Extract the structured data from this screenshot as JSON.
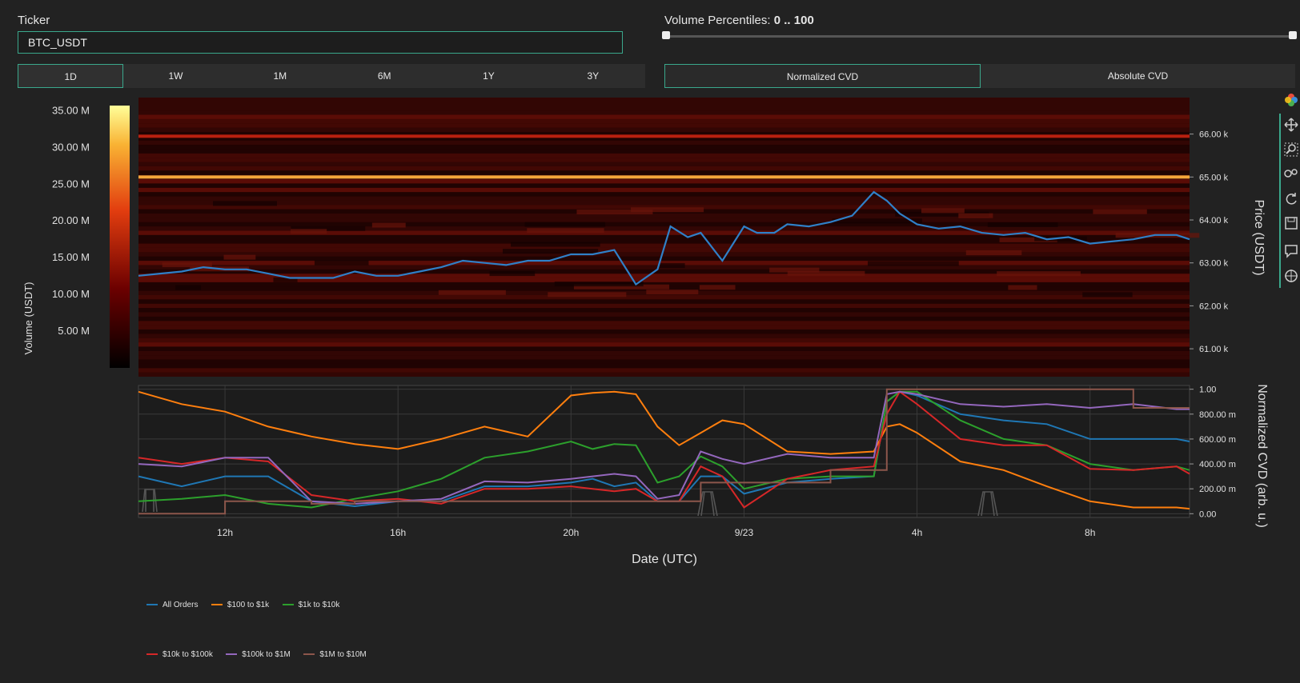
{
  "ticker": {
    "label": "Ticker",
    "value": "BTC_USDT"
  },
  "volume_percentiles": {
    "label": "Volume Percentiles:",
    "value": "0 .. 100"
  },
  "ranges": [
    {
      "label": "1D",
      "active": true
    },
    {
      "label": "1W",
      "active": false
    },
    {
      "label": "1M",
      "active": false
    },
    {
      "label": "6M",
      "active": false
    },
    {
      "label": "1Y",
      "active": false
    },
    {
      "label": "3Y",
      "active": false
    }
  ],
  "cvd_modes": [
    {
      "label": "Normalized CVD",
      "active": true
    },
    {
      "label": "Absolute CVD",
      "active": false
    }
  ],
  "toolbar_icons": [
    "color-wheel-icon",
    "pan-icon",
    "zoom-icon",
    "compare-icon",
    "reset-icon",
    "save-icon",
    "comment-icon",
    "crosshair-icon"
  ],
  "chart_data": [
    {
      "type": "heatmap",
      "colorbar_title": "Volume (USDT)",
      "colorbar_ticks": [
        "35.00 M",
        "30.00 M",
        "25.00 M",
        "20.00 M",
        "15.00 M",
        "10.00 M",
        "5.00 M"
      ],
      "colorbar_values": [
        35,
        30,
        25,
        20,
        15,
        10,
        5
      ],
      "colorbar_range": [
        0,
        35.7
      ],
      "ylabel": "Price (USDT)",
      "y_ticks": [
        "66.00 k",
        "65.00 k",
        "64.00 k",
        "63.00 k",
        "62.00 k",
        "61.00 k"
      ],
      "y_tick_values": [
        66000,
        65000,
        64000,
        63000,
        62000,
        61000
      ],
      "ylim": [
        60350,
        66850
      ],
      "highlight_levels": [
        {
          "price": 65000,
          "volume_m": 28
        },
        {
          "price": 65950,
          "volume_m": 11
        }
      ],
      "price_series": {
        "x": [
          10.0,
          10.5,
          11.0,
          11.5,
          12.0,
          12.5,
          13.0,
          13.5,
          14.0,
          14.5,
          15.0,
          15.5,
          16.0,
          16.5,
          17.0,
          17.5,
          18.0,
          18.5,
          19.0,
          19.5,
          20.0,
          20.5,
          21.0,
          21.5,
          22.0,
          22.3,
          22.7,
          23.0,
          23.5,
          24.0,
          24.3,
          24.7,
          25.0,
          25.5,
          26.0,
          26.5,
          27.0,
          27.3,
          27.6,
          28.0,
          28.5,
          29.0,
          29.5,
          30.0,
          30.5,
          31.0,
          31.5,
          32.0,
          32.5,
          33.0,
          33.5,
          34.0,
          34.3
        ],
        "y": [
          62700,
          62750,
          62800,
          62900,
          62850,
          62850,
          62750,
          62650,
          62650,
          62650,
          62800,
          62700,
          62700,
          62800,
          62900,
          63050,
          63000,
          62950,
          63050,
          63050,
          63200,
          63200,
          63300,
          62500,
          62850,
          63850,
          63600,
          63700,
          63050,
          63850,
          63700,
          63700,
          63900,
          63850,
          63950,
          64100,
          64650,
          64450,
          64150,
          63900,
          63800,
          63850,
          63700,
          63650,
          63700,
          63550,
          63600,
          63450,
          63500,
          63550,
          63650,
          63650,
          63550
        ]
      },
      "xlabel": "Date (UTC)",
      "x_ticks": [
        "12h",
        "16h",
        "20h",
        "9/23",
        "4h",
        "8h"
      ],
      "x_tick_values": [
        12,
        16,
        20,
        24,
        28,
        32
      ],
      "xlim": [
        10,
        34.3
      ]
    },
    {
      "type": "line",
      "ylabel": "Normalized CVD (arb. u.)",
      "y_ticks": [
        "1.00",
        "800.00 m",
        "600.00 m",
        "400.00 m",
        "200.00 m",
        "0.00"
      ],
      "y_tick_values": [
        1.0,
        0.8,
        0.6,
        0.4,
        0.2,
        0.0
      ],
      "ylim": [
        -0.03,
        1.03
      ],
      "xlabel": "Date (UTC)",
      "x_ticks": [
        "12h",
        "16h",
        "20h",
        "9/23",
        "4h",
        "8h"
      ],
      "x_tick_values": [
        12,
        16,
        20,
        24,
        28,
        32
      ],
      "xlim": [
        10,
        34.3
      ],
      "x": [
        10,
        11,
        12,
        13,
        14,
        15,
        16,
        17,
        18,
        19,
        20,
        20.5,
        21,
        21.5,
        22,
        22.5,
        23,
        23.5,
        24,
        25,
        26,
        27,
        27.3,
        27.6,
        28,
        29,
        30,
        31,
        32,
        33,
        34,
        34.3
      ],
      "series": [
        {
          "name": "All Orders",
          "color": "#1f77b4",
          "values": [
            0.3,
            0.22,
            0.3,
            0.3,
            0.1,
            0.06,
            0.1,
            0.1,
            0.22,
            0.22,
            0.25,
            0.28,
            0.22,
            0.25,
            0.1,
            0.1,
            0.3,
            0.3,
            0.16,
            0.25,
            0.28,
            0.3,
            0.9,
            0.98,
            0.95,
            0.8,
            0.75,
            0.72,
            0.6,
            0.6,
            0.6,
            0.58
          ]
        },
        {
          "name": "$100 to $1k",
          "color": "#ff7f0e",
          "values": [
            0.98,
            0.88,
            0.82,
            0.7,
            0.62,
            0.56,
            0.52,
            0.6,
            0.7,
            0.62,
            0.95,
            0.97,
            0.98,
            0.96,
            0.7,
            0.55,
            0.65,
            0.75,
            0.72,
            0.5,
            0.48,
            0.5,
            0.7,
            0.72,
            0.65,
            0.42,
            0.35,
            0.22,
            0.1,
            0.05,
            0.05,
            0.04
          ]
        },
        {
          "name": "$1k to $10k",
          "color": "#2ca02c",
          "values": [
            0.1,
            0.12,
            0.15,
            0.08,
            0.05,
            0.12,
            0.18,
            0.28,
            0.45,
            0.5,
            0.58,
            0.52,
            0.56,
            0.55,
            0.25,
            0.3,
            0.46,
            0.38,
            0.2,
            0.28,
            0.3,
            0.3,
            0.9,
            0.98,
            0.98,
            0.75,
            0.6,
            0.55,
            0.4,
            0.35,
            0.38,
            0.35
          ]
        },
        {
          "name": "$10k to $100k",
          "color": "#d62728",
          "values": [
            0.45,
            0.4,
            0.45,
            0.42,
            0.15,
            0.1,
            0.12,
            0.08,
            0.2,
            0.2,
            0.22,
            0.2,
            0.18,
            0.2,
            0.1,
            0.1,
            0.38,
            0.3,
            0.05,
            0.28,
            0.35,
            0.38,
            0.8,
            0.98,
            0.88,
            0.6,
            0.55,
            0.55,
            0.36,
            0.35,
            0.38,
            0.32
          ]
        },
        {
          "name": "$100k to $1M",
          "color": "#9467bd",
          "values": [
            0.4,
            0.38,
            0.45,
            0.45,
            0.1,
            0.08,
            0.1,
            0.12,
            0.26,
            0.25,
            0.28,
            0.3,
            0.32,
            0.3,
            0.12,
            0.15,
            0.5,
            0.44,
            0.4,
            0.48,
            0.45,
            0.45,
            0.96,
            0.98,
            0.96,
            0.88,
            0.86,
            0.88,
            0.85,
            0.88,
            0.84,
            0.84
          ]
        },
        {
          "name": "$1M to $10M",
          "color": "#8c564b",
          "values": [
            0.0,
            0.0,
            0.1,
            0.1,
            0.08,
            0.1,
            0.1,
            0.1,
            0.1,
            0.1,
            0.1,
            0.1,
            0.1,
            0.1,
            0.1,
            0.1,
            0.25,
            0.25,
            0.25,
            0.25,
            0.35,
            0.35,
            1.0,
            1.0,
            1.0,
            1.0,
            1.0,
            1.0,
            1.0,
            0.85,
            0.85,
            0.85
          ]
        }
      ]
    }
  ]
}
